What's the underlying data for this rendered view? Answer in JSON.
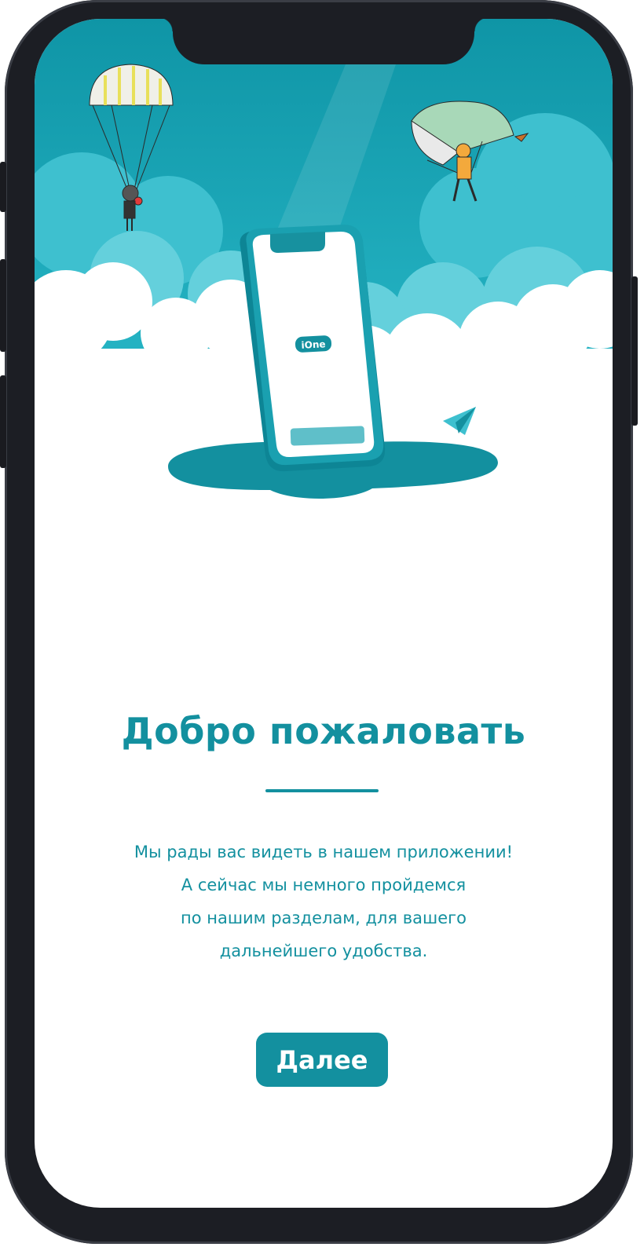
{
  "app": {
    "logo_text": "iOne"
  },
  "welcome": {
    "title": "Добро пожаловать",
    "description_lines": [
      "Мы рады вас видеть в нашем приложении!",
      "А сейчас мы немного пройдемся",
      "по нашим разделам, для вашего",
      "дальнейшего удобства."
    ],
    "next_label": "Далее"
  },
  "colors": {
    "accent": "#13909f",
    "sky": "#1aa3b3",
    "cloud": "#ffffff"
  },
  "icons": [
    "parachutist-left",
    "parachutist-right",
    "phone-illustration",
    "paper-plane-icon"
  ]
}
